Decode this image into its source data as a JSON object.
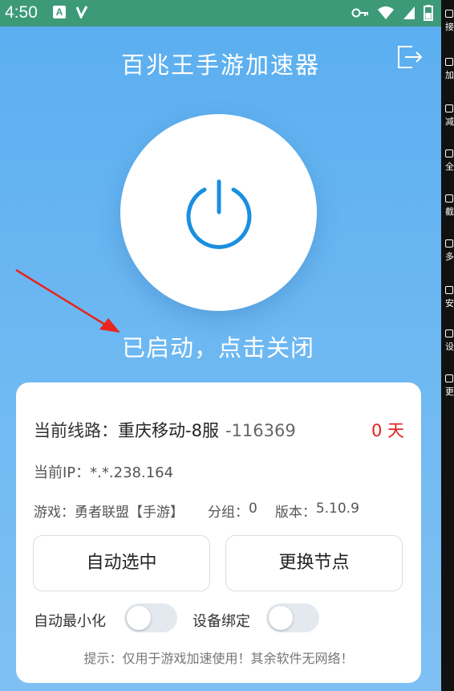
{
  "status_bar": {
    "time": "4:50",
    "notification_letter": "A"
  },
  "app": {
    "title": "百兆王手游加速器",
    "status_text": "已启动，点击关闭"
  },
  "card": {
    "route_label": "当前线路：",
    "route_name": "重庆移动-8服",
    "route_id": "-116369",
    "days": "0 天",
    "ip_label": "当前IP：",
    "ip_value": "*.*.238.164",
    "game_label": "游戏：",
    "game_value": "勇者联盟【手游】",
    "group_label": "分组：",
    "group_value": "0",
    "version_label": "版本：",
    "version_value": "5.10.9",
    "auto_select_button": "自动选中",
    "change_node_button": "更换节点",
    "auto_minimize_label": "自动最小化",
    "device_bind_label": "设备绑定",
    "auto_minimize_on": false,
    "device_bind_on": false,
    "hint": "提示：仅用于游戏加速使用！其余软件无网络！"
  },
  "sidebar": {
    "items": [
      "接",
      "加",
      "减",
      "全",
      "截",
      "多",
      "安",
      "设",
      "更"
    ]
  },
  "colors": {
    "accent": "#1a8fe0",
    "status_bar": "#3c9a78",
    "days": "#e0201e",
    "arrow": "#e8251f"
  }
}
